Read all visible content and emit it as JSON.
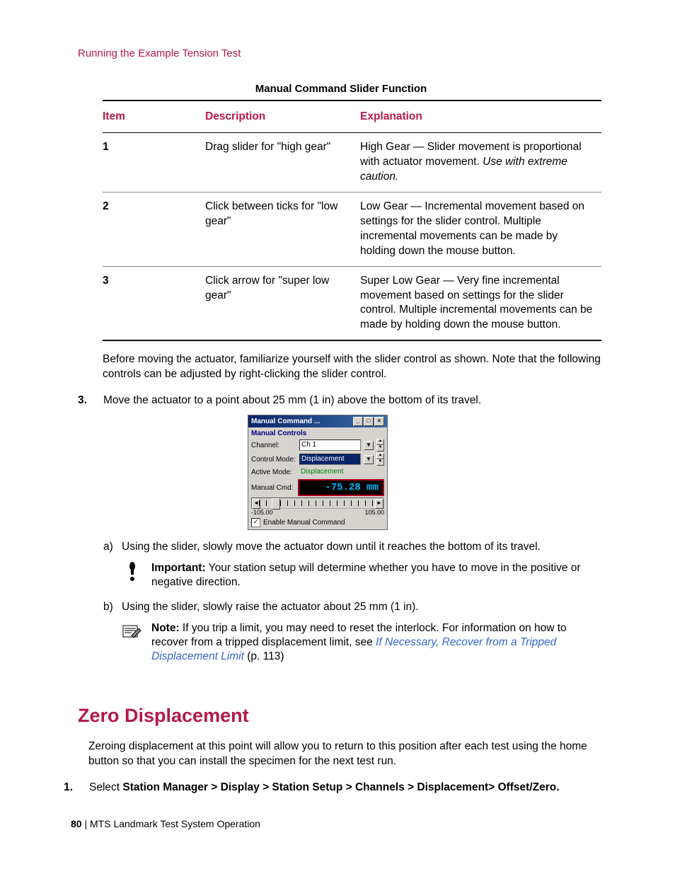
{
  "runningHead": "Running the Example Tension Test",
  "tableCaption": "Manual Command Slider Function",
  "headers": {
    "item": "Item",
    "description": "Description",
    "explanation": "Explanation"
  },
  "rows": [
    {
      "item": "1",
      "desc": "Drag slider for \"high gear\"",
      "expl": "High Gear — Slider movement is proportional with actuator movement. ",
      "explItalic": "Use with extreme caution."
    },
    {
      "item": "2",
      "desc": "Click between ticks for \"low gear\"",
      "expl": "Low Gear — Incremental movement based on settings for the slider control. Multiple incremental movements can be made by holding down the mouse button.",
      "explItalic": ""
    },
    {
      "item": "3",
      "desc": "Click arrow for \"super low gear\"",
      "expl": "Super Low Gear — Very fine incremental movement based on settings for the slider control. Multiple incremental movements can be made by holding down the mouse button.",
      "explItalic": ""
    }
  ],
  "paraBefore": "Before moving the actuator, familiarize yourself with the slider control as shown. Note that the following controls can be adjusted by right-clicking the slider control.",
  "step3": {
    "num": "3.",
    "text": "Move the actuator to a point about 25 mm (1 in) above the bottom of its travel."
  },
  "dialog": {
    "title": "Manual Command ...",
    "section": "Manual Controls",
    "channelLabel": "Channel:",
    "channelValue": "Ch 1",
    "controlModeLabel": "Control Mode:",
    "controlModeValue": "Displacement",
    "activeModeLabel": "Active Mode:",
    "activeModeValue": "Displacement",
    "manualCmdLabel": "Manual Cmd:",
    "lcd": "-75.28  mm",
    "rangeMin": "-105.00",
    "rangeMax": "105.00",
    "enableLabel": "Enable Manual Command",
    "enableChecked": "✓",
    "arrowLeft": "◄",
    "arrowRight": "►",
    "spinUp": "▲",
    "spinDown": "▼",
    "dropdown": "▼",
    "minBtn": "_",
    "maxBtn": "□",
    "closeBtn": "×"
  },
  "subA": {
    "mark": "a)",
    "text": "Using the slider, slowly move the actuator down until it reaches the bottom of its travel."
  },
  "important": {
    "label": "Important:",
    "text": " Your station setup will determine whether you have to move in the positive or negative direction."
  },
  "subB": {
    "mark": "b)",
    "text": "Using the slider, slowly raise the actuator about 25 mm (1 in)."
  },
  "note": {
    "label": "Note:",
    "t1": " If you trip a limit, you may need to reset the interlock. For information on how to recover from a tripped displacement limit, see ",
    "link": "If Necessary, Recover from a Tripped Displacement Limit",
    "t2": "  (p. 113)"
  },
  "h1": "Zero Displacement",
  "zeroPara": "Zeroing displacement at this point will allow you to return to this position after each test using the home button so that you can install the specimen for the next test run.",
  "step1z": {
    "num": "1.",
    "lead": "Select ",
    "bold": "Station Manager > Display > Station Setup > Channels > Displacement> Offset/Zero."
  },
  "footer": {
    "page": "80",
    "sep": " | ",
    "title": "MTS Landmark Test System Operation"
  }
}
